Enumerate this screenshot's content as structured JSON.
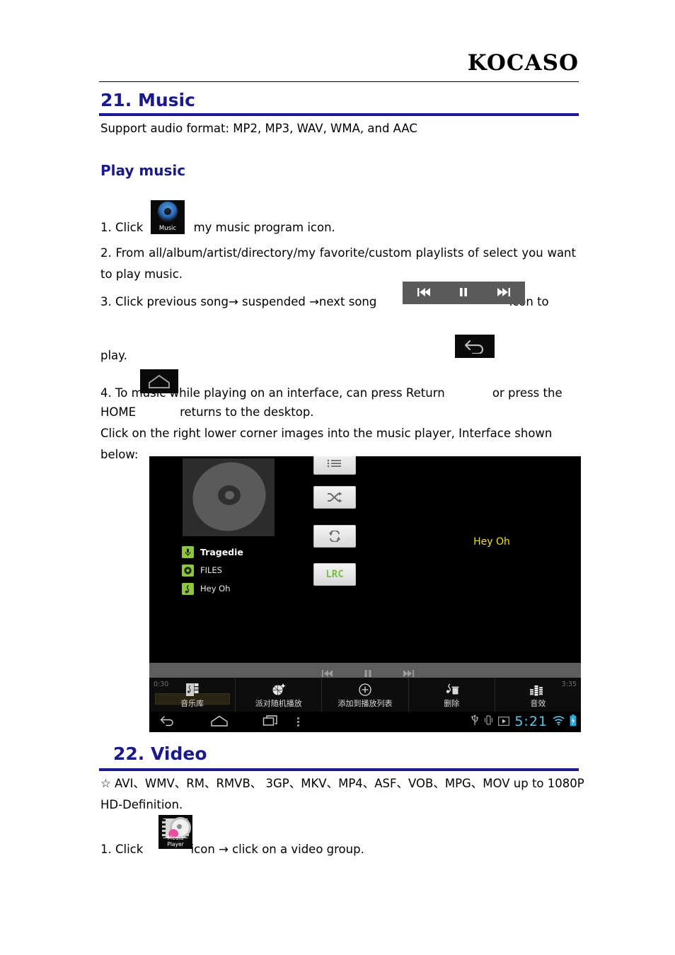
{
  "header": {
    "brand": "KOCASO"
  },
  "section_music": {
    "heading": "21. Music",
    "support_line": "Support audio format: MP2, MP3, WAV, WMA, and AAC",
    "sub_heading": "Play music",
    "step1_before": "1. Click",
    "step1_after": "my music program icon.",
    "step2": "2. From all/album/artist/directory/my favorite/custom playlists of select you want to play music.",
    "step3_before": "3. Click previous song→ suspended →next song",
    "step3_after": "icon to",
    "step3_cont": "play.",
    "step4_before": "4. To music while playing on an interface, can press Return",
    "step4_mid": "or press the",
    "step4_home_label": "HOME",
    "step4_after": "returns to the desktop.",
    "step4_note": "Click on the right lower corner images into the music player, Interface shown below:",
    "music_icon_label": "Music"
  },
  "device_screenshot": {
    "now_playing_lyric": "Hey Oh",
    "meta": [
      {
        "icon": "microphone-icon",
        "label": "Tragedie"
      },
      {
        "icon": "disc-icon",
        "label": "FILES"
      },
      {
        "icon": "music-note-icon",
        "label": "Hey Oh"
      }
    ],
    "side_buttons": [
      {
        "icon": "playlist-icon",
        "label": ""
      },
      {
        "icon": "shuffle-icon",
        "label": ""
      },
      {
        "icon": "repeat-icon",
        "label": ""
      },
      {
        "icon": "lrc-icon",
        "label": "LRC"
      }
    ],
    "elapsed_time": "0:30",
    "total_time": "3:35",
    "toolbar": [
      {
        "icon": "music-library-icon",
        "label": "音乐库"
      },
      {
        "icon": "party-shuffle-icon",
        "label": "派对随机播放"
      },
      {
        "icon": "add-to-playlist-icon",
        "label": "添加到播放列表"
      },
      {
        "icon": "delete-icon",
        "label": "删除"
      },
      {
        "icon": "equalizer-icon",
        "label": "音效"
      }
    ],
    "statusbar": {
      "clock": "5:21",
      "icons": [
        "usb-icon",
        "vibrate-icon",
        "play-icon",
        "wifi-icon",
        "battery-icon"
      ]
    },
    "nav_icons": [
      "back-icon",
      "home-icon",
      "recents-icon",
      "menu-icon"
    ]
  },
  "section_video": {
    "heading_num": "22",
    "heading_sep": ".",
    "heading_text": "Video",
    "formats": "☆ AVI、WMV、RM、RMVB、 3GP、MKV、MP4、ASF、VOB、MPG、MOV up to 1080P HD-Definition.",
    "step1_before": "1. Click",
    "step1_after": "icon → click on a video group.",
    "media_icon_label": "Media Player"
  },
  "colors": {
    "heading_blue": "#1a1a8c",
    "lyric_yellow": "#f2e20c",
    "accent_green": "#8dc63f",
    "clock_cyan": "#5ec8e8"
  }
}
